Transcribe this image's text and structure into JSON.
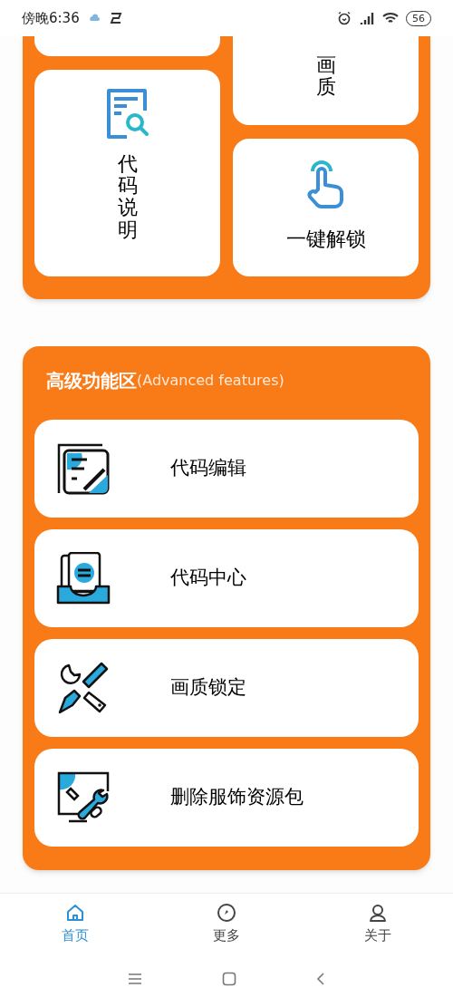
{
  "status_bar": {
    "time": "傍晚6:36",
    "battery": "56"
  },
  "top_grid": {
    "left": [
      {
        "kind": "stub"
      },
      {
        "kind": "code-explain",
        "label": "代码说明"
      }
    ],
    "right": [
      {
        "kind": "cut",
        "label": "画质"
      },
      {
        "kind": "unlock",
        "label": "一键解锁"
      }
    ]
  },
  "advanced": {
    "title": "高级功能区",
    "subtitle": "(Advanced features)",
    "items": [
      {
        "kind": "edit",
        "label": "代码编辑"
      },
      {
        "kind": "center",
        "label": "代码中心"
      },
      {
        "kind": "tools",
        "label": "画质锁定"
      },
      {
        "kind": "delete",
        "label": "删除服饰资源包"
      }
    ]
  },
  "bottom_nav": [
    {
      "kind": "home",
      "label": "首页",
      "selected": true
    },
    {
      "kind": "compass",
      "label": "更多",
      "selected": false
    },
    {
      "kind": "person",
      "label": "关于",
      "selected": false
    }
  ]
}
